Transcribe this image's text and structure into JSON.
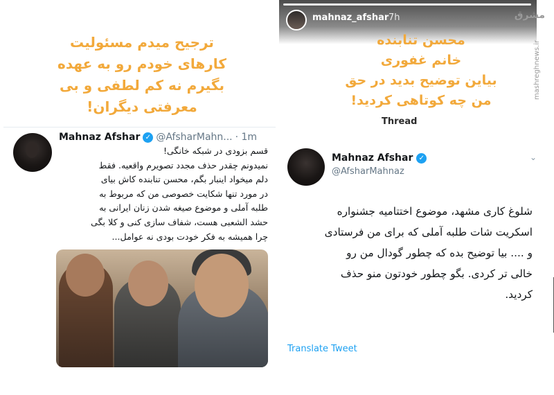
{
  "left_caption": {
    "line1": "ترجیح میدم مسئولیت",
    "line2": "کارهای خودم رو به عهده",
    "line3": "بگیرم نه کم لطفی و بی",
    "line4": "معرفتی دیگران!"
  },
  "left_tweet": {
    "name": "Mahnaz Afshar",
    "handle": "@AfsharMahn...",
    "time": "· 1m",
    "lines": [
      "قسم بزودی  در شبکه خانگی!",
      "نمیدونم چقدر حذف مجدد تصویرم واقعیه. فقط",
      "دلم میخواد اینبار بگم، محسن تنابنده کاش بیای",
      "در مورد تنها شکایت خصوصی من که مربوط به",
      "طلبه آملی و موضوع صیغه شدن زنان ایرانی به",
      "حشد الشعبی هست، شفاف سازی کنی و کلا بگی",
      "چرا همیشه به فکر خودت بودی نه عوامل..."
    ]
  },
  "story": {
    "username": "mahnaz_afshar",
    "time": "7h"
  },
  "right_caption": {
    "line1": "محسن تنابنده",
    "line2": "خانم غفوری",
    "line3": "بیاین توضیح بدید در حق",
    "line4": "من چه کوتاهی کردید!"
  },
  "right_thread_label": "Thread",
  "right_tweet": {
    "name": "Mahnaz Afshar",
    "handle": "@AfsharMahnaz",
    "lines": [
      "شلوغ کاری مشهد، موضوع اختتامیه جشنواره",
      "اسکریت شات طلبه آملی که برای من فرستادی",
      "و .... بیا توضیح بده که چطور گودال من رو",
      "خالی تر کردی. بگو چطور خودتون منو حذف",
      "کردید."
    ],
    "translate": "Translate Tweet"
  },
  "watermark": {
    "logo": "مشرق",
    "site": "mashreghnews.ir"
  },
  "colors": {
    "caption": "#f2a93b",
    "verified": "#1da1f2",
    "link": "#1da1f2"
  }
}
